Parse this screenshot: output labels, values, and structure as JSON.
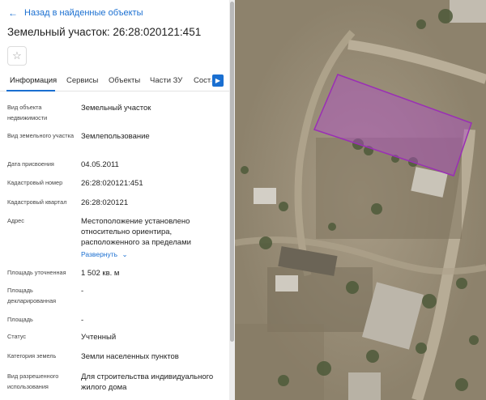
{
  "back": {
    "label": "Назад в найденные объекты",
    "icon": "arrow-left-icon"
  },
  "title": "Земельный участок: 26:28:020121:451",
  "favorite_icon": "star-outline-icon",
  "tabs": [
    {
      "label": "Информация"
    },
    {
      "label": "Сервисы"
    },
    {
      "label": "Объекты"
    },
    {
      "label": "Части ЗУ"
    },
    {
      "label": "Соста"
    }
  ],
  "fields": [
    {
      "label": "Вид объекта недвижимости",
      "value": "Земельный участок"
    },
    {
      "label": "Вид земельного участка",
      "value": "Землепользование"
    },
    {
      "label": "Дата присвоения",
      "value": "04.05.2011"
    },
    {
      "label": "Кадастровый номер",
      "value": "26:28:020121:451"
    },
    {
      "label": "Кадастровый квартал",
      "value": "26:28:020121"
    },
    {
      "label": "Адрес",
      "value": "Местоположение установлено относительно ориентира, расположенного за пределами"
    },
    {
      "label": "Площадь уточненная",
      "value": "1 502 кв. м"
    },
    {
      "label": "Площадь декларированная",
      "value": "-"
    },
    {
      "label": "Площадь",
      "value": "-"
    },
    {
      "label": "Статус",
      "value": "Учтенный"
    },
    {
      "label": "Категория земель",
      "value": "Земли населенных пунктов"
    },
    {
      "label": "Вид разрешенного использования",
      "value": "Для строительства индивидуального жилого дома"
    }
  ],
  "expand_label": "Развернуть",
  "colors": {
    "accent": "#1a6fd1",
    "parcel_fill": "#b04cc8",
    "parcel_stroke": "#9a2fb5"
  }
}
